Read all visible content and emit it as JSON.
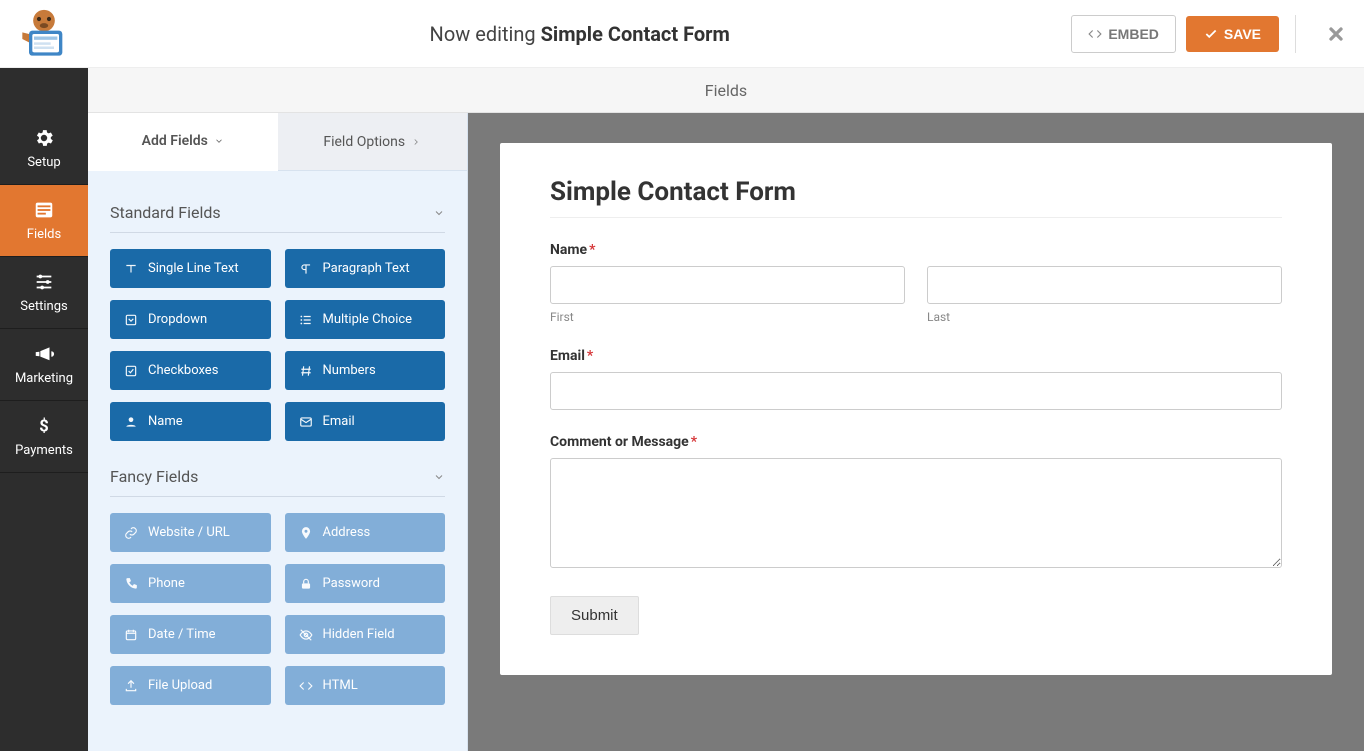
{
  "header": {
    "editing_prefix": "Now editing ",
    "form_name": "Simple Contact Form",
    "embed_label": "EMBED",
    "save_label": "SAVE"
  },
  "sidebar": {
    "items": [
      {
        "label": "Setup",
        "icon": "gear-icon"
      },
      {
        "label": "Fields",
        "icon": "form-icon",
        "active": true
      },
      {
        "label": "Settings",
        "icon": "sliders-icon"
      },
      {
        "label": "Marketing",
        "icon": "bullhorn-icon"
      },
      {
        "label": "Payments",
        "icon": "dollar-icon"
      }
    ]
  },
  "panel": {
    "header": "Fields",
    "tabs": {
      "add_fields": "Add Fields",
      "field_options": "Field Options"
    },
    "groups": [
      {
        "title": "Standard Fields",
        "style": "solid",
        "items": [
          {
            "label": "Single Line Text",
            "icon": "text-icon"
          },
          {
            "label": "Paragraph Text",
            "icon": "paragraph-icon"
          },
          {
            "label": "Dropdown",
            "icon": "caret-square-icon"
          },
          {
            "label": "Multiple Choice",
            "icon": "list-icon"
          },
          {
            "label": "Checkboxes",
            "icon": "check-square-icon"
          },
          {
            "label": "Numbers",
            "icon": "hash-icon"
          },
          {
            "label": "Name",
            "icon": "user-icon"
          },
          {
            "label": "Email",
            "icon": "envelope-icon"
          }
        ]
      },
      {
        "title": "Fancy Fields",
        "style": "light",
        "items": [
          {
            "label": "Website / URL",
            "icon": "link-icon"
          },
          {
            "label": "Address",
            "icon": "map-pin-icon"
          },
          {
            "label": "Phone",
            "icon": "phone-icon"
          },
          {
            "label": "Password",
            "icon": "lock-icon"
          },
          {
            "label": "Date / Time",
            "icon": "calendar-icon"
          },
          {
            "label": "Hidden Field",
            "icon": "eye-slash-icon"
          },
          {
            "label": "File Upload",
            "icon": "upload-icon"
          },
          {
            "label": "HTML",
            "icon": "code-icon"
          }
        ]
      }
    ]
  },
  "preview": {
    "title": "Simple Contact Form",
    "name_label": "Name",
    "first_sub": "First",
    "last_sub": "Last",
    "email_label": "Email",
    "message_label": "Comment or Message",
    "submit_label": "Submit"
  }
}
